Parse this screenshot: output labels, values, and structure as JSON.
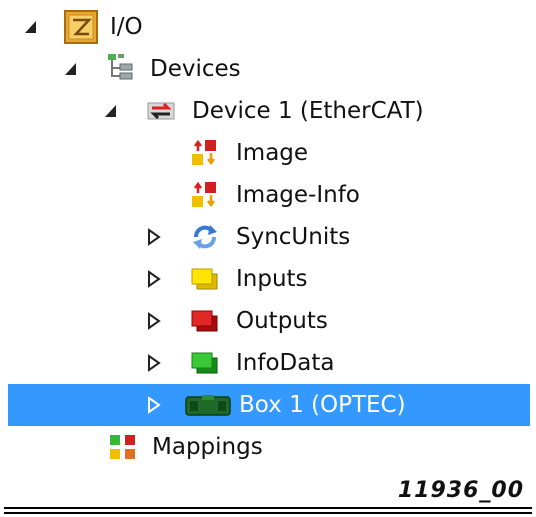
{
  "tree": {
    "io": {
      "label": "I/O",
      "icon": "io-folder-icon",
      "expanded": true
    },
    "devices": {
      "label": "Devices",
      "icon": "devices-tree-icon",
      "expanded": true
    },
    "device1": {
      "label": "Device 1 (EtherCAT)",
      "icon": "ethercat-device-icon",
      "expanded": true
    },
    "image": {
      "label": "Image",
      "icon": "process-image-icon"
    },
    "image_info": {
      "label": "Image-Info",
      "icon": "process-image-icon"
    },
    "syncunits": {
      "label": "SyncUnits",
      "icon": "sync-arrows-icon",
      "expanded": false
    },
    "inputs": {
      "label": "Inputs",
      "icon": "inputs-yellow-icon",
      "expanded": false
    },
    "outputs": {
      "label": "Outputs",
      "icon": "outputs-red-icon",
      "expanded": false
    },
    "infodata": {
      "label": "InfoData",
      "icon": "infodata-green-icon",
      "expanded": false
    },
    "box1": {
      "label": "Box 1 (OPTEC)",
      "icon": "box-module-icon",
      "expanded": false,
      "selected": true
    },
    "mappings": {
      "label": "Mappings",
      "icon": "mappings-icon"
    }
  },
  "figure_id": "11936_00",
  "colors": {
    "selection": "#3399ff",
    "inputs": "#f5d800",
    "outputs": "#d01818",
    "infodata": "#20b020"
  }
}
